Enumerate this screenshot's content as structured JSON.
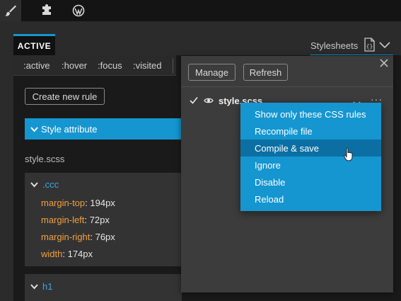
{
  "toolbar": {
    "icons": [
      "paintbrush-icon",
      "puzzle-piece-icon",
      "wordpress-logo-icon"
    ]
  },
  "tab": {
    "active_label": "ACTIVE"
  },
  "stylesheets": {
    "label": "Stylesheets",
    "icon": "css-braces-icon"
  },
  "states": [
    ":active",
    ":hover",
    ":focus",
    ":visited"
  ],
  "buttons": {
    "create_new_rule": "Create new rule",
    "manage": "Manage",
    "refresh": "Refresh"
  },
  "style_attribute": {
    "label": "Style attribute"
  },
  "file_label": "style.scss",
  "rules": [
    {
      "selector": ".ccc",
      "declarations": [
        {
          "prop": "margin-top",
          "value": "194px"
        },
        {
          "prop": "margin-left",
          "value": "72px"
        },
        {
          "prop": "margin-right",
          "value": "76px"
        },
        {
          "prop": "width",
          "value": "174px"
        }
      ]
    },
    {
      "selector": "h1",
      "declarations": []
    }
  ],
  "popover": {
    "sheet_name": "style.scss",
    "menu": [
      "Show only these CSS rules",
      "Recompile file",
      "Compile & save",
      "Ignore",
      "Disable",
      "Reload"
    ],
    "hovered_item": "Compile & save"
  },
  "colors": {
    "accent": "#1596d0",
    "menu_hover": "#0c6fa3",
    "property": "#f0a040",
    "selector": "#3aa7e0"
  }
}
